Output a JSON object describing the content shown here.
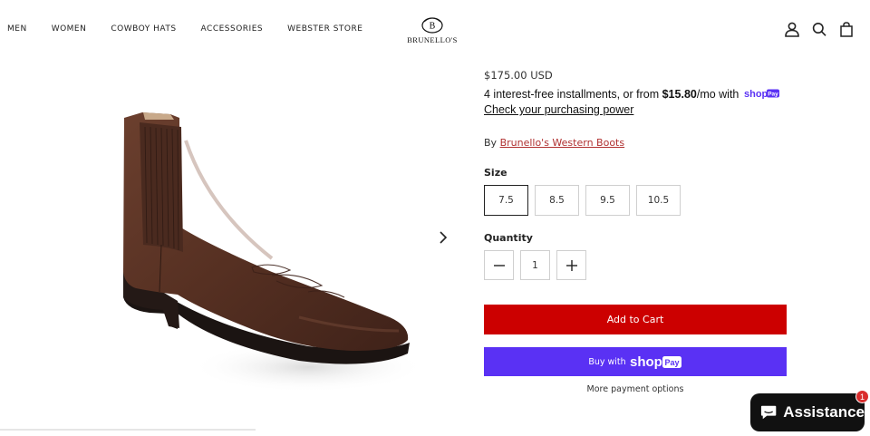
{
  "nav": {
    "items": [
      "MEN",
      "WOMEN",
      "COWBOY HATS",
      "ACCESSORIES",
      "WEBSTER STORE"
    ]
  },
  "brand": {
    "name": "BRUNELLO'S",
    "monogram": "B"
  },
  "header_icons": [
    "account-icon",
    "search-icon",
    "cart-icon"
  ],
  "product": {
    "price": "$175.00 USD",
    "installments_prefix": "4 interest-free installments, or from ",
    "installments_amount": "$15.80",
    "installments_suffix": "/mo with",
    "shop_pay_text": "shop",
    "shop_pay_tag": "Pay",
    "check_power": "Check your purchasing power",
    "vendor_prefix": "By",
    "vendor": "Brunello's Western Boots",
    "size_label": "Size",
    "sizes": [
      "7.5",
      "8.5",
      "9.5",
      "10.5"
    ],
    "selected_size": "7.5",
    "quantity_label": "Quantity",
    "quantity": "1",
    "add_to_cart": "Add to Cart",
    "buy_with": "Buy with",
    "buy_shop_text": "shop",
    "buy_shop_tag": "Pay",
    "more_payment": "More payment options"
  },
  "chat": {
    "label": "Assistance",
    "badge_count": "1"
  },
  "colors": {
    "add_to_cart": "#cc0000",
    "shop_pay": "#5a31f4",
    "vendor_link": "#b03030",
    "boot_leather": "#5a3426",
    "chat_bg": "#111111",
    "badge": "#d92d2d"
  }
}
